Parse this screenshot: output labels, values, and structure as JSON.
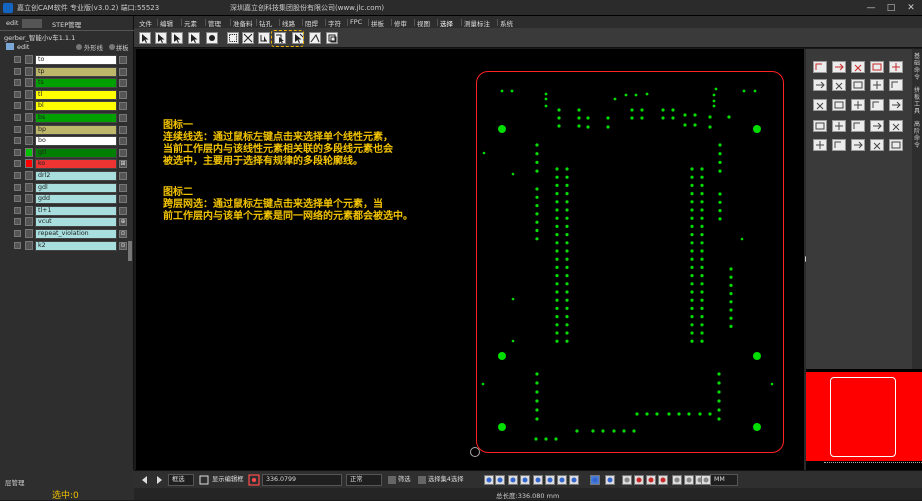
{
  "titlebar": {
    "title": "嘉立创CAM软件 专业版(v3.0.2) 端口:55523",
    "company": "深圳嘉立创科技集团股份有限公司(www.jlc.com)",
    "minimize": "—",
    "maximize": "□",
    "close": "✕"
  },
  "menu": [
    "文件",
    "编辑",
    "元素",
    "管理",
    "准备料",
    "钻孔",
    "线路",
    "阻焊",
    "字符",
    "FPC",
    "拼板",
    "修审",
    "视图",
    "选择",
    "测量标注",
    "系统"
  ],
  "menu_active_index": 13,
  "left_panel": {
    "tabs": {
      "edit": "edit",
      "step": "STEP管理"
    },
    "project": "gerber_智能小v车1.1.1",
    "edit_label": "edit",
    "radio_outline": "外形线",
    "radio_panel": "拼板",
    "layers": [
      {
        "name": "to",
        "color": "#ffffff",
        "c2": "#555555",
        "icon": ""
      },
      {
        "name": "tp",
        "color": "#bdb76b",
        "c2": "#555555",
        "icon": ""
      },
      {
        "name": "ts",
        "color": "#00a000",
        "c2": "#555555",
        "icon": ""
      },
      {
        "name": "tl",
        "color": "#ffff00",
        "c2": "#555555",
        "icon": ""
      },
      {
        "name": "bl",
        "color": "#ffff00",
        "c2": "#555555",
        "icon": ""
      },
      {
        "name": "bs",
        "color": "#00a000",
        "c2": "#555555",
        "icon": ""
      },
      {
        "name": "bp",
        "color": "#bdb76b",
        "c2": "#555555",
        "icon": ""
      },
      {
        "name": "bo",
        "color": "#ffffff",
        "c2": "#555555",
        "icon": ""
      },
      {
        "name": "gtl",
        "color": "#008000",
        "c2": "#00c000",
        "icon": ""
      },
      {
        "name": "ko",
        "color": "#ee3333",
        "c2": "#ff0000",
        "icon": "⊞"
      },
      {
        "name": "drl2",
        "color": "#a8dede",
        "c2": "#555555",
        "icon": ""
      },
      {
        "name": "gdl",
        "color": "#a8dede",
        "c2": "#555555",
        "icon": ""
      },
      {
        "name": "gdd",
        "color": "#a8dede",
        "c2": "#555555",
        "icon": ""
      },
      {
        "name": "tl+1",
        "color": "#a8dede",
        "c2": "#555555",
        "icon": ""
      },
      {
        "name": "vcut",
        "color": "#a8dede",
        "c2": "#555555",
        "icon": "⊕"
      },
      {
        "name": "repeat_violation",
        "color": "#a8dede",
        "c2": "#555555",
        "icon": "⊙"
      },
      {
        "name": "k2",
        "color": "#a8dede",
        "c2": "#555555",
        "icon": "⊙"
      }
    ],
    "layer_manager": "层管理",
    "selected": "选中:0"
  },
  "annotations": {
    "a1": [
      "图标一",
      "连续线选：通过鼠标左键点击来选择单个线性元素，",
      "当前工作层内与该线性元素相关联的多段线元素也会",
      "被选中，主要用于选择有规律的多段轮廓线。"
    ],
    "a2": [
      "图标二",
      "跨层网选：通过鼠标左键点击来选择单个元素，当",
      "前工作层内与该单个元素是同一网络的元素都会被选中。"
    ]
  },
  "right_tabs": [
    "基础命令",
    "拼板工具",
    "高阶命令"
  ],
  "bottom": {
    "mode": "框选",
    "show_label": "显示编辑框",
    "coord": "336.0799",
    "normal": "正常",
    "filter": "筛选",
    "select_all": "选择集4选择",
    "unit": "MM"
  },
  "status": {
    "total_length": "总长度:336.080 mm"
  },
  "colors": {
    "board_outline": "#ff2222",
    "pads": "#00dd00",
    "annotation": "#f2c200"
  }
}
